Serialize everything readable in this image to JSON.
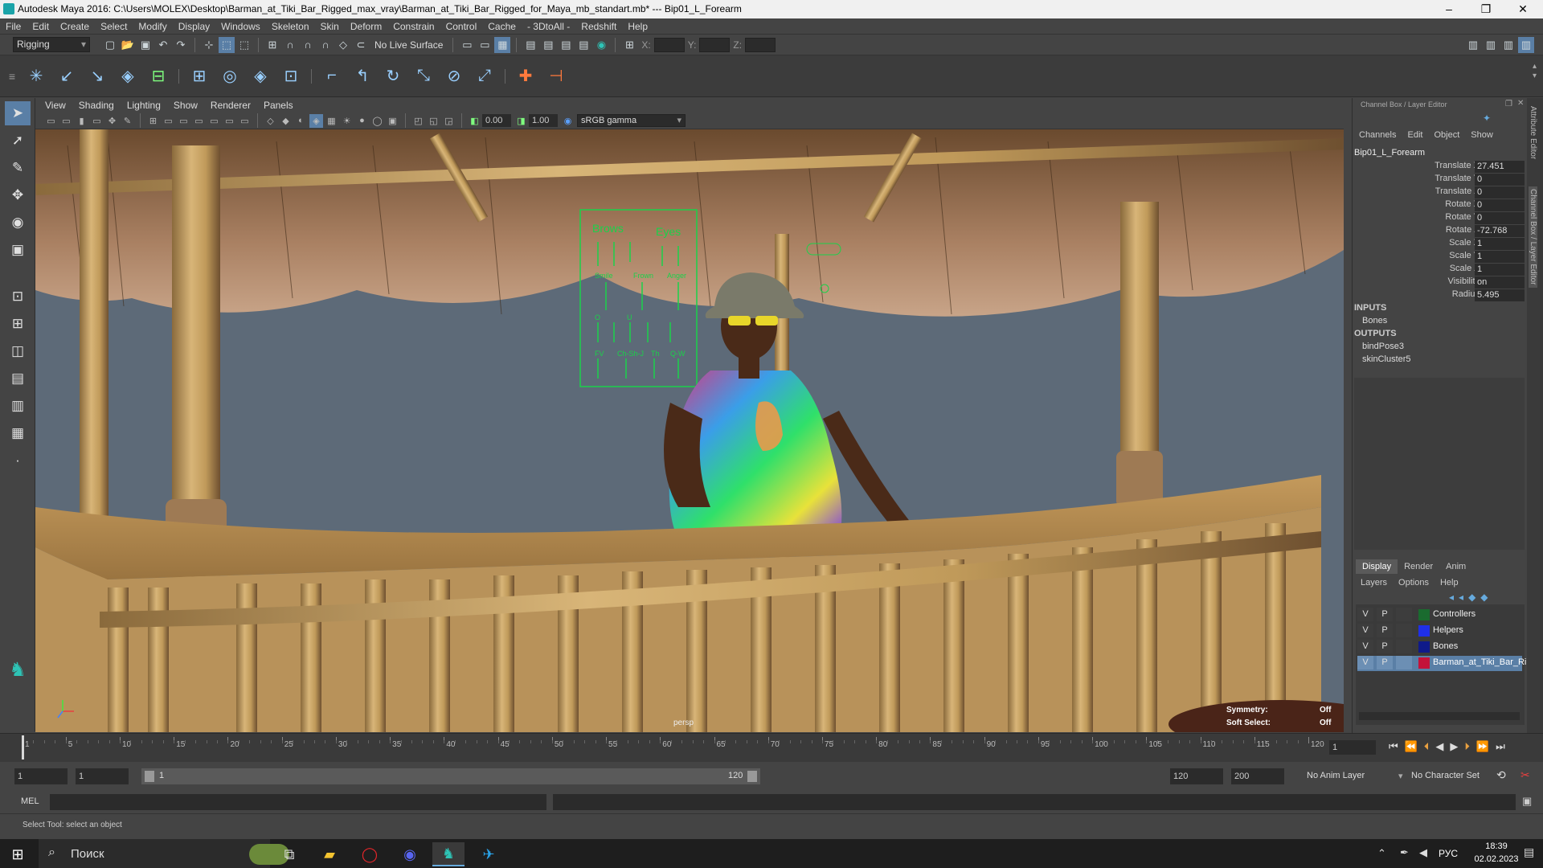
{
  "window": {
    "title": "Autodesk Maya 2016: C:\\Users\\MOLEX\\Desktop\\Barman_at_Tiki_Bar_Rigged_max_vray\\Barman_at_Tiki_Bar_Rigged_for_Maya_mb_standart.mb*  ---  Bip01_L_Forearm",
    "minimize": "–",
    "maximize": "❐",
    "close": "✕"
  },
  "menu": [
    "File",
    "Edit",
    "Create",
    "Select",
    "Modify",
    "Display",
    "Windows",
    "Skeleton",
    "Skin",
    "Deform",
    "Constrain",
    "Control",
    "Cache",
    "- 3DtoAll -",
    "Redshift",
    "Help"
  ],
  "statusbar": {
    "mode": "Rigging",
    "live_surface": "No Live Surface",
    "x_label": "X:",
    "y_label": "Y:",
    "z_label": "Z:"
  },
  "viewport": {
    "menu": [
      "View",
      "Shading",
      "Lighting",
      "Show",
      "Renderer",
      "Panels"
    ],
    "exposure": "0.00",
    "gamma": "1.00",
    "colorspace": "sRGB gamma",
    "camera": "persp",
    "symmetry_label": "Symmetry:",
    "symmetry_value": "Off",
    "softselect_label": "Soft Select:",
    "softselect_value": "Off"
  },
  "panel": {
    "header": "Brows Eyes",
    "labels": [
      "Brows",
      "Eyes",
      "Smile",
      "Frown",
      "Anger",
      "O",
      "U",
      "FV",
      "Ch-Sh-J",
      "Th",
      "Q-W"
    ]
  },
  "channelbox": {
    "title": "Channel Box / Layer Editor",
    "menu": [
      "Channels",
      "Edit",
      "Object",
      "Show"
    ],
    "node": "Bip01_L_Forearm",
    "attrs": [
      {
        "name": "Translate X",
        "value": "27.451"
      },
      {
        "name": "Translate Y",
        "value": "0"
      },
      {
        "name": "Translate Z",
        "value": "0"
      },
      {
        "name": "Rotate X",
        "value": "0"
      },
      {
        "name": "Rotate Y",
        "value": "0"
      },
      {
        "name": "Rotate Z",
        "value": "-72.768"
      },
      {
        "name": "Scale X",
        "value": "1"
      },
      {
        "name": "Scale Y",
        "value": "1"
      },
      {
        "name": "Scale Z",
        "value": "1"
      },
      {
        "name": "Visibility",
        "value": "on"
      },
      {
        "name": "Radius",
        "value": "5.495"
      }
    ],
    "inputs_label": "INPUTS",
    "inputs": [
      "Bones"
    ],
    "outputs_label": "OUTPUTS",
    "outputs": [
      "bindPose3",
      "skinCluster5"
    ]
  },
  "layers": {
    "tabs": [
      "Display",
      "Render",
      "Anim"
    ],
    "menu": [
      "Layers",
      "Options",
      "Help"
    ],
    "items": [
      {
        "v": "V",
        "p": "P",
        "name": "Controllers",
        "color": "#1a6b2f"
      },
      {
        "v": "V",
        "p": "P",
        "name": "Helpers",
        "color": "#1f2fe8"
      },
      {
        "v": "V",
        "p": "P",
        "name": "Bones",
        "color": "#0f1a8a"
      },
      {
        "v": "V",
        "p": "P",
        "name": "Barman_at_Tiki_Bar_Ri",
        "color": "#c4123a"
      }
    ]
  },
  "sidetabs": [
    "Attribute Editor",
    "Channel Box / Layer Editor"
  ],
  "timeline": {
    "ticks": [
      "1",
      "5",
      "10",
      "15",
      "20",
      "25",
      "30",
      "35",
      "40",
      "45",
      "50",
      "55",
      "60",
      "65",
      "70",
      "75",
      "80",
      "85",
      "90",
      "95",
      "100",
      "105",
      "110",
      "115",
      "120"
    ],
    "current": "1"
  },
  "range": {
    "start": "1",
    "playstart": "1",
    "inner": "1",
    "innerend": "120",
    "end": "120",
    "max": "200",
    "anim_layer": "No Anim Layer",
    "char_set": "No Character Set"
  },
  "mel": {
    "label": "MEL"
  },
  "help": "Select Tool: select an object",
  "taskbar": {
    "search": "Поиск",
    "lang": "РУС",
    "time": "18:39",
    "date": "02.02.2023"
  }
}
